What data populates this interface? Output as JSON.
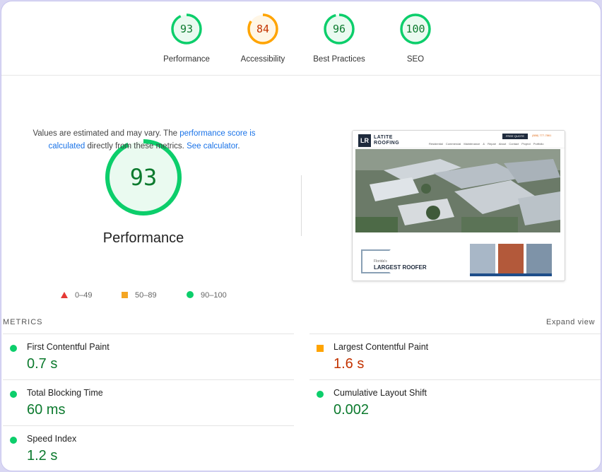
{
  "colors": {
    "pass": "#0cce6b",
    "average": "#ffa400",
    "fail": "#ff4e42",
    "pass_text": "#0c7a2e",
    "average_text": "#c33300",
    "link": "#1a73e8"
  },
  "categories": [
    {
      "score": "93",
      "label": "Performance",
      "rating": "pass"
    },
    {
      "score": "84",
      "label": "Accessibility",
      "rating": "average"
    },
    {
      "score": "96",
      "label": "Best Practices",
      "rating": "pass"
    },
    {
      "score": "100",
      "label": "SEO",
      "rating": "pass"
    }
  ],
  "performance": {
    "score": "93",
    "title": "Performance",
    "note_prefix": "Values are estimated and may vary. The ",
    "note_link1": "performance score is calculated",
    "note_middle": " directly from these metrics. ",
    "note_link2": "See calculator",
    "note_suffix": "."
  },
  "legend": [
    {
      "range": "0–49",
      "shape": "triangle"
    },
    {
      "range": "50–89",
      "shape": "square"
    },
    {
      "range": "90–100",
      "shape": "circle"
    }
  ],
  "screenshot": {
    "logo_letters": "LR",
    "brand_line1": "LATITE",
    "brand_line2": "ROOFING",
    "quote_btn": "FREE QUOTE",
    "phone": "(888) 777-7861",
    "nav": "Residential Commercial Maintenance & Repair About Contact Project Portfolio",
    "tagline_small": "Florida's",
    "tagline_large": "LARGEST ROOFER"
  },
  "metrics": {
    "header": "METRICS",
    "expand": "Expand view",
    "items": [
      {
        "name": "First Contentful Paint",
        "value": "0.7 s",
        "rating": "pass"
      },
      {
        "name": "Largest Contentful Paint",
        "value": "1.6 s",
        "rating": "average"
      },
      {
        "name": "Total Blocking Time",
        "value": "60 ms",
        "rating": "pass"
      },
      {
        "name": "Cumulative Layout Shift",
        "value": "0.002",
        "rating": "pass"
      },
      {
        "name": "Speed Index",
        "value": "1.2 s",
        "rating": "pass"
      }
    ]
  }
}
